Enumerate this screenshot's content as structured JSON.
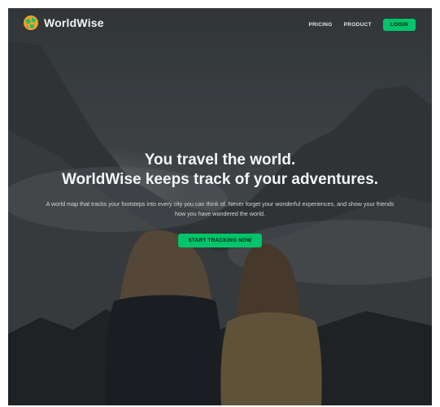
{
  "app": {
    "name": "WorldWise",
    "logo_icon": "globe-icon",
    "accent_color": "#00c46a"
  },
  "nav": {
    "links": [
      {
        "label": "PRICING"
      },
      {
        "label": "PRODUCT"
      }
    ],
    "login_label": "LOGIN"
  },
  "hero": {
    "title_line1": "You travel the world.",
    "title_line2": "WorldWise keeps track of your adventures.",
    "subtitle": "A world map that tracks your footsteps into every city you can think of. Never forget your wonderful experiences, and show your friends how you have wandered the world.",
    "cta_label": "START TRACKING NOW"
  },
  "background": {
    "description_icon": "mountain-landscape-photo"
  }
}
